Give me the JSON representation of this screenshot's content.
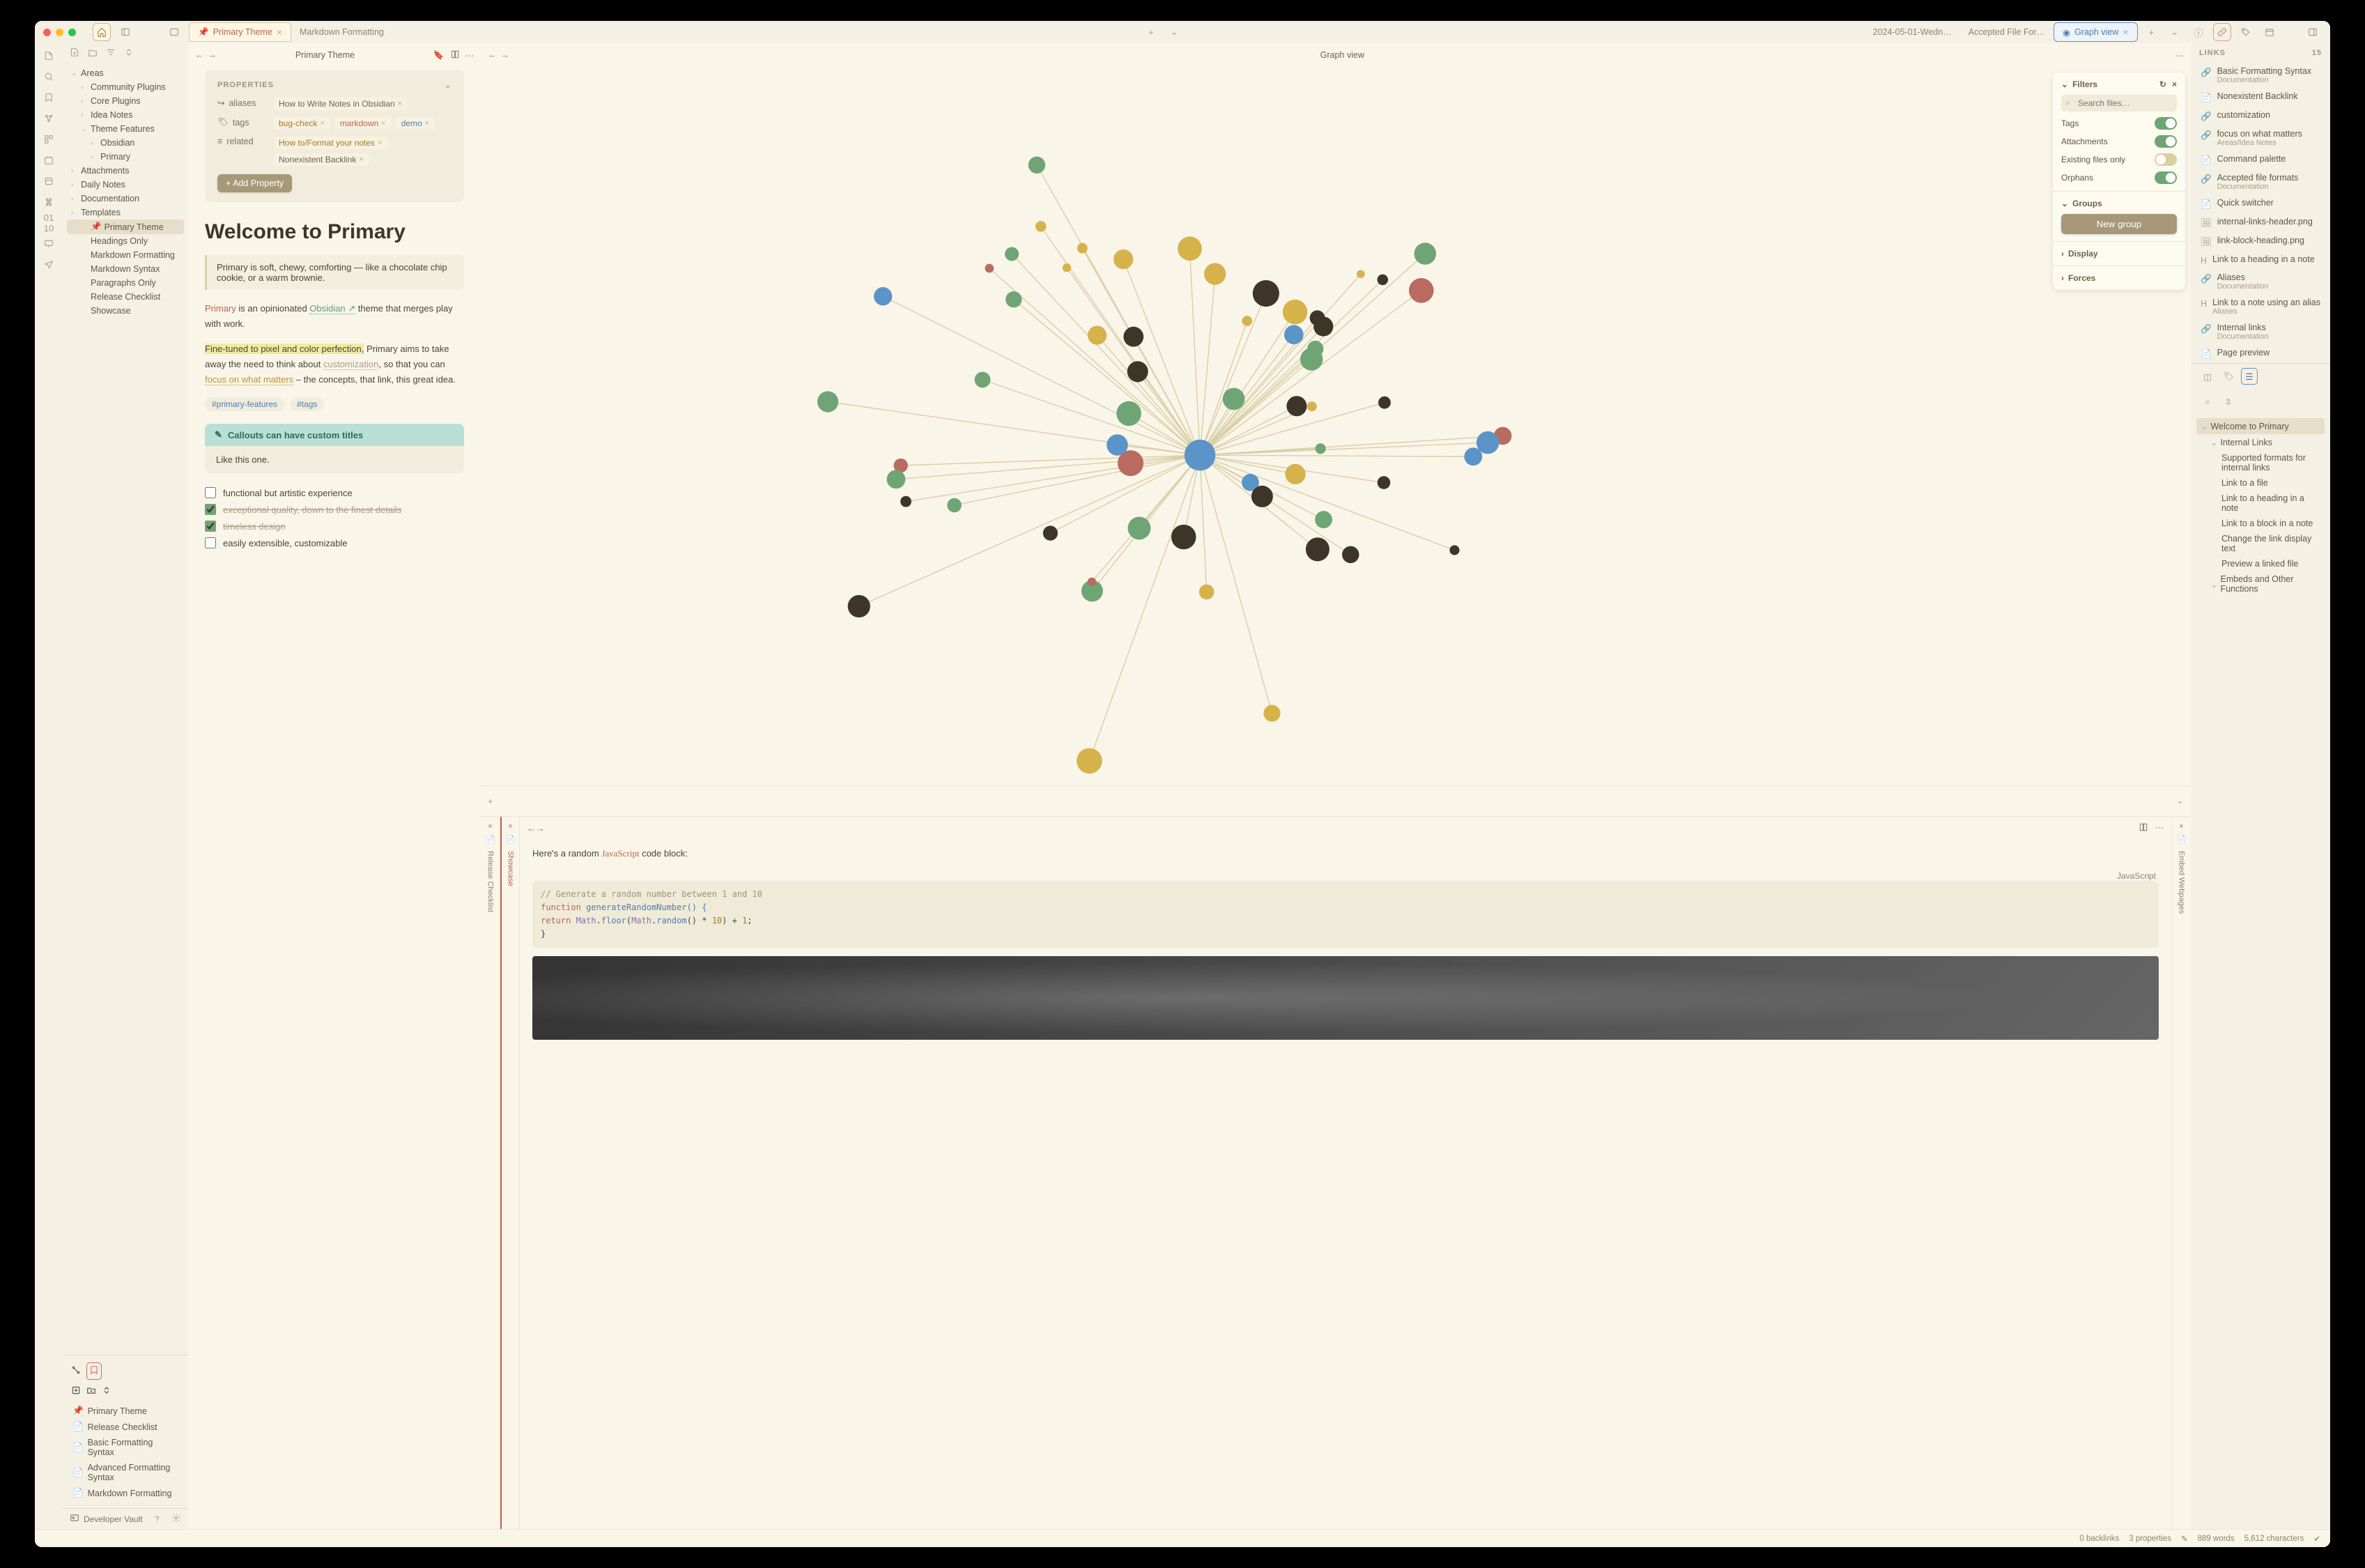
{
  "titlebar": {
    "tabs_left": [
      {
        "label": "Primary Theme",
        "active": true,
        "pinned": true,
        "close": true
      },
      {
        "label": "Markdown Formatting",
        "active": false
      }
    ],
    "tabs_right": [
      {
        "label": "2024-05-01-Wedn…",
        "active": false
      },
      {
        "label": "Accepted File For…",
        "active": false
      },
      {
        "label": "Graph view",
        "active": true,
        "graph": true,
        "close": true
      }
    ]
  },
  "sidebar": {
    "tree": [
      {
        "label": "Areas",
        "lvl": 0,
        "open": true
      },
      {
        "label": "Community Plugins",
        "lvl": 1
      },
      {
        "label": "Core Plugins",
        "lvl": 1
      },
      {
        "label": "Idea Notes",
        "lvl": 1
      },
      {
        "label": "Theme Features",
        "lvl": 1,
        "open": true
      },
      {
        "label": "Obsidian",
        "lvl": 2
      },
      {
        "label": "Primary",
        "lvl": 2
      },
      {
        "label": "Attachments",
        "lvl": 0
      },
      {
        "label": "Daily Notes",
        "lvl": 0
      },
      {
        "label": "Documentation",
        "lvl": 0
      },
      {
        "label": "Templates",
        "lvl": 0
      },
      {
        "label": "Primary Theme",
        "lvl": 1,
        "file": true,
        "active": true
      },
      {
        "label": "Headings Only",
        "lvl": 1,
        "file": true
      },
      {
        "label": "Markdown Formatting",
        "lvl": 1,
        "file": true
      },
      {
        "label": "Markdown Syntax",
        "lvl": 1,
        "file": true
      },
      {
        "label": "Paragraphs Only",
        "lvl": 1,
        "file": true
      },
      {
        "label": "Release Checklist",
        "lvl": 1,
        "file": true
      },
      {
        "label": "Showcase",
        "lvl": 1,
        "file": true
      }
    ],
    "bookmarks": [
      "Primary Theme",
      "Release Checklist",
      "Basic Formatting Syntax",
      "Advanced Formatting Syntax",
      "Markdown Formatting"
    ],
    "footer": {
      "vault": "Developer Vault"
    }
  },
  "editor": {
    "tab_title": "Primary Theme",
    "properties_label": "PROPERTIES",
    "props": {
      "aliases_label": "aliases",
      "aliases": [
        "How to Write Notes in Obsidian"
      ],
      "tags_label": "tags",
      "tags": [
        {
          "text": "bug-check",
          "cls": "y"
        },
        {
          "text": "markdown",
          "cls": "r"
        },
        {
          "text": "demo",
          "cls": "b"
        }
      ],
      "related_label": "related",
      "related": [
        "How to/Format your notes",
        "Nonexistent Backlink"
      ]
    },
    "add_property": "Add Property",
    "title": "Welcome to Primary",
    "quote": "Primary is soft, chewy, comforting — like a chocolate chip cookie, or a warm brownie.",
    "p1_a": "Primary",
    "p1_b": " is an opinionated ",
    "p1_c": "Obsidian",
    "p1_d": " theme that merges play with work.",
    "p2_a": "Fine-tuned to pixel and color perfection,",
    "p2_b": " Primary aims to take away the need to think about ",
    "p2_c": "customization",
    "p2_d": ", so that you can ",
    "p2_e": "focus on what matters",
    "p2_f": " – the concepts, that link, this great idea.",
    "inline_tags": [
      "#primary-features",
      "#tags"
    ],
    "callout_title": "Callouts can have custom titles",
    "callout_body": "Like this one.",
    "tasks": [
      {
        "text": "functional but artistic experience",
        "done": false
      },
      {
        "text": "exceptional quality, down to the finest details",
        "done": true
      },
      {
        "text": "timeless design",
        "done": true
      },
      {
        "text": "easily extensible, customizable",
        "done": false
      }
    ]
  },
  "graph": {
    "tab_title": "Graph view",
    "panel": {
      "filters": "Filters",
      "search_ph": "Search files…",
      "rows": [
        {
          "label": "Tags",
          "on": true
        },
        {
          "label": "Attachments",
          "on": true
        },
        {
          "label": "Existing files only",
          "on": false
        },
        {
          "label": "Orphans",
          "on": true
        }
      ],
      "groups": "Groups",
      "new_group": "New group",
      "display": "Display",
      "forces": "Forces"
    }
  },
  "showcase": {
    "vlabel_left": "Release Checklist",
    "vlabel_mid": "Showcase",
    "vlabel_right": "Embed Webpages",
    "intro_a": "Here's a random ",
    "intro_code": "JavaScript",
    "intro_b": " code block:",
    "lang": "JavaScript",
    "code": {
      "l1": "// Generate a random number between 1 and 10",
      "l2a": "function",
      "l2b": " generateRandomNumber() {",
      "l3a": "    return ",
      "l3b": "Math",
      "l3c": ".",
      "l3d": "floor",
      "l3e": "(",
      "l3f": "Math",
      "l3g": ".",
      "l3h": "random",
      "l3i": "() * ",
      "l3j": "10",
      "l3k": ") + ",
      "l3l": "1",
      "l3m": ";",
      "l4": "}"
    }
  },
  "rhs": {
    "links_label": "LINKS",
    "links_count": "15",
    "links": [
      {
        "icon": "link",
        "title": "Basic Formatting Syntax",
        "sub": "Documentation"
      },
      {
        "icon": "file",
        "title": "Nonexistent Backlink"
      },
      {
        "icon": "link",
        "title": "customization"
      },
      {
        "icon": "link",
        "title": "focus on what matters",
        "sub": "Areas/Idea Notes"
      },
      {
        "icon": "file",
        "title": "Command palette"
      },
      {
        "icon": "link",
        "title": "Accepted file formats",
        "sub": "Documentation"
      },
      {
        "icon": "file",
        "title": "Quick switcher"
      },
      {
        "icon": "image",
        "title": "internal-links-header.png"
      },
      {
        "icon": "image",
        "title": "link-block-heading.png"
      },
      {
        "icon": "heading",
        "title": "Link to a heading in a note"
      },
      {
        "icon": "link",
        "title": "Aliases",
        "sub": "Documentation"
      },
      {
        "icon": "heading",
        "title": "Link to a note using an alias",
        "sub": "Aliases"
      },
      {
        "icon": "link",
        "title": "Internal links",
        "sub": "Documentation"
      },
      {
        "icon": "file",
        "title": "Page preview"
      }
    ],
    "outline": [
      {
        "label": "Welcome to Primary",
        "lvl": 0,
        "active": true
      },
      {
        "label": "Internal Links",
        "lvl": 1
      },
      {
        "label": "Supported formats for internal links",
        "lvl": 2
      },
      {
        "label": "Link to a file",
        "lvl": 2
      },
      {
        "label": "Link to a heading in a note",
        "lvl": 2
      },
      {
        "label": "Link to a block in a note",
        "lvl": 2
      },
      {
        "label": "Change the link display text",
        "lvl": 2
      },
      {
        "label": "Preview a linked file",
        "lvl": 2
      },
      {
        "label": "Embeds and Other Functions",
        "lvl": 1
      }
    ]
  },
  "status": {
    "backlinks": "0 backlinks",
    "props": "3 properties",
    "words": "889 words",
    "chars": "5,612 characters"
  }
}
